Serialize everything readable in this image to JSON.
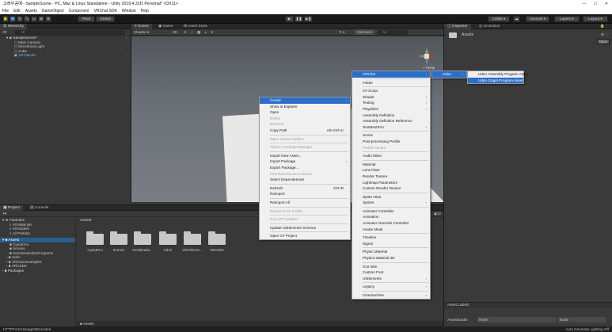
{
  "window": {
    "title": "고래우공예 - SampleScene - PC, Mac & Linux Standalone - Unity 2019.4.31f1 Personal* <DX11>",
    "min": "—",
    "max": "☐",
    "close": "✕"
  },
  "menubar": [
    "File",
    "Edit",
    "Assets",
    "GameObject",
    "Component",
    "VRChat SDK",
    "Window",
    "Help"
  ],
  "toolbar": {
    "pivot": "Pivot",
    "global": "Global",
    "collab": "Collab",
    "account": "Account",
    "layers": "Layers",
    "layout": "Layout"
  },
  "hierarchy": {
    "tab": "Hierarchy",
    "search_placeholder": "All",
    "scene": "SampleScene*",
    "items": [
      "Main Camera",
      "Directional Light",
      "Cube",
      "VRCWorld"
    ]
  },
  "scene": {
    "tabs": [
      "Scene",
      "Game",
      "Asset Store"
    ],
    "shaded": "Shaded",
    "mode2d": "2D",
    "gizmos": "Gizmos",
    "search": "All",
    "persp": "< Persp"
  },
  "inspector": {
    "tabs": [
      "Inspector",
      "Occlusion"
    ],
    "title": "Assets",
    "open": "Open",
    "asset_labels": "Asset Labels",
    "assetbundle": "AssetBundle",
    "none1": "None",
    "none2": "None",
    "lighting": "Auto Generate Lighting Off"
  },
  "project": {
    "tabs": [
      "Project",
      "Console"
    ],
    "favorites": "Favorites",
    "fav_items": [
      "All Materials",
      "All Models",
      "All Prefabs"
    ],
    "assets_root": "Assets",
    "asset_items": [
      "CyanEmu",
      "Scenes",
      "SerializedUdonPrograms",
      "Udon",
      "VRChat Examples",
      "VRCSDK"
    ],
    "packages": "Packages",
    "breadcrumb": "Assets",
    "folders": [
      "CyanEmu",
      "Scenes",
      "Serializedu...",
      "Udon",
      "VRChat Ex...",
      "VRCSDK"
    ],
    "footer": "Assets",
    "count": "13"
  },
  "context_menu": [
    {
      "label": "Create",
      "arrow": "›",
      "hl": true
    },
    {
      "label": "Show in Explorer"
    },
    {
      "label": "Open"
    },
    {
      "label": "Delete",
      "dis": true
    },
    {
      "label": "Rename",
      "dis": true
    },
    {
      "label": "Copy Path",
      "sc": "Alt+Ctrl+C"
    },
    {
      "sep": true
    },
    {
      "label": "Open Scene Additive",
      "dis": true
    },
    {
      "sep": true
    },
    {
      "label": "View in Package Manager",
      "dis": true
    },
    {
      "sep": true
    },
    {
      "label": "Import New Asset..."
    },
    {
      "label": "Import Package",
      "arrow": "›"
    },
    {
      "label": "Export Package..."
    },
    {
      "label": "Find References In Scene",
      "dis": true
    },
    {
      "label": "Select Dependencies"
    },
    {
      "sep": true
    },
    {
      "label": "Refresh",
      "sc": "Ctrl+R"
    },
    {
      "label": "Reimport"
    },
    {
      "sep": true
    },
    {
      "label": "Reimport All"
    },
    {
      "sep": true
    },
    {
      "label": "Extract From Prefab",
      "dis": true
    },
    {
      "sep": true
    },
    {
      "label": "Run API Updater...",
      "dis": true
    },
    {
      "sep": true
    },
    {
      "label": "Update UIElements Schema"
    },
    {
      "sep": true
    },
    {
      "label": "Open C# Project"
    }
  ],
  "create_menu": [
    {
      "label": "VRChat",
      "arrow": "›",
      "hl": true
    },
    {
      "sep": true
    },
    {
      "label": "Folder"
    },
    {
      "sep": true
    },
    {
      "label": "C# Script"
    },
    {
      "label": "Shader",
      "arrow": "›"
    },
    {
      "label": "Testing",
      "arrow": "›"
    },
    {
      "label": "Playables",
      "arrow": "›"
    },
    {
      "label": "Assembly Definition"
    },
    {
      "label": "Assembly Definition Reference"
    },
    {
      "label": "TextMeshPro",
      "arrow": "›"
    },
    {
      "sep": true
    },
    {
      "label": "Scene"
    },
    {
      "label": "Post-processing Profile"
    },
    {
      "label": "Prefab Variant",
      "dis": true
    },
    {
      "sep": true
    },
    {
      "label": "Audio Mixer"
    },
    {
      "sep": true
    },
    {
      "label": "Material"
    },
    {
      "label": "Lens Flare"
    },
    {
      "label": "Render Texture"
    },
    {
      "label": "Lightmap Parameters"
    },
    {
      "label": "Custom Render Texture"
    },
    {
      "sep": true
    },
    {
      "label": "Sprite Atlas"
    },
    {
      "label": "Sprites",
      "arrow": "›"
    },
    {
      "sep": true
    },
    {
      "label": "Animator Controller"
    },
    {
      "label": "Animation"
    },
    {
      "label": "Animator Override Controller"
    },
    {
      "label": "Avatar Mask"
    },
    {
      "sep": true
    },
    {
      "label": "Timeline"
    },
    {
      "label": "Signal"
    },
    {
      "sep": true
    },
    {
      "label": "Physic Material"
    },
    {
      "label": "Physics Material 2D"
    },
    {
      "sep": true
    },
    {
      "label": "GUI Skin"
    },
    {
      "label": "Custom Font"
    },
    {
      "label": "UIElements",
      "arrow": "›"
    },
    {
      "sep": true
    },
    {
      "label": "Legacy",
      "arrow": "›"
    },
    {
      "sep": true
    },
    {
      "label": "Cinemachine",
      "arrow": "›"
    }
  ],
  "vrchat_menu": [
    {
      "label": "Udon",
      "arrow": "›",
      "hl": true
    }
  ],
  "udon_menu": [
    {
      "label": "Udon Assembly Program Asset"
    },
    {
      "label": "Udon Graph Program Asset",
      "hl": true
    }
  ],
  "status": "HTTPFormUseageIsEncoded"
}
